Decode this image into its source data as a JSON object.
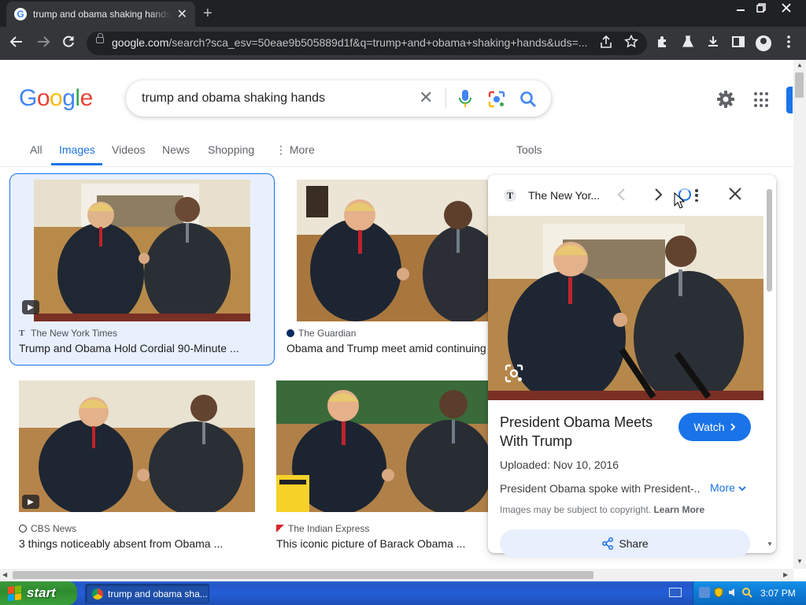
{
  "browser": {
    "tab_title": "trump and obama shaking hands - Google Search",
    "tab_close": "✕",
    "new_tab": "+",
    "url_host": "google.com",
    "url_path": "/search?sca_esv=50eae9b505889d1f&q=trump+and+obama+shaking+hands&uds=..."
  },
  "search": {
    "logo": [
      "G",
      "o",
      "o",
      "g",
      "l",
      "e"
    ],
    "query": "trump and obama shaking hands",
    "clear": "✕"
  },
  "tabs": [
    {
      "label": "All"
    },
    {
      "label": "Images"
    },
    {
      "label": "Videos"
    },
    {
      "label": "News"
    },
    {
      "label": "Shopping"
    },
    {
      "label": "⋮ More"
    }
  ],
  "tools_label": "Tools",
  "results": [
    {
      "source": "The New York Times",
      "title": "Trump and Obama Hold Cordial 90-Minute ..."
    },
    {
      "source": "The Guardian",
      "title": "Obama and Trump meet amid continuing"
    },
    {
      "source": "CBS News",
      "title": "3 things noticeably absent from Obama ..."
    },
    {
      "source": "The Indian Express",
      "title": "This iconic picture of Barack Obama ..."
    }
  ],
  "panel": {
    "source": "The New Yor...",
    "title": "President Obama Meets With Trump",
    "watch_label": "Watch",
    "uploaded": "Uploaded: Nov 10, 2016",
    "description": "President Obama spoke with President-...",
    "more_label": "More",
    "copyright_text": "Images may be subject to copyright.",
    "learn_more": "Learn More",
    "share_label": "Share"
  },
  "taskbar": {
    "start_label": "start",
    "task_button": "trump and obama sha...",
    "clock": "3:07 PM"
  },
  "colors": {
    "accent": "#1a73e8",
    "selected_card_bg": "#e8f0fe",
    "taskbar_blue": "#245dd7",
    "start_green": "#3c9a3c"
  }
}
